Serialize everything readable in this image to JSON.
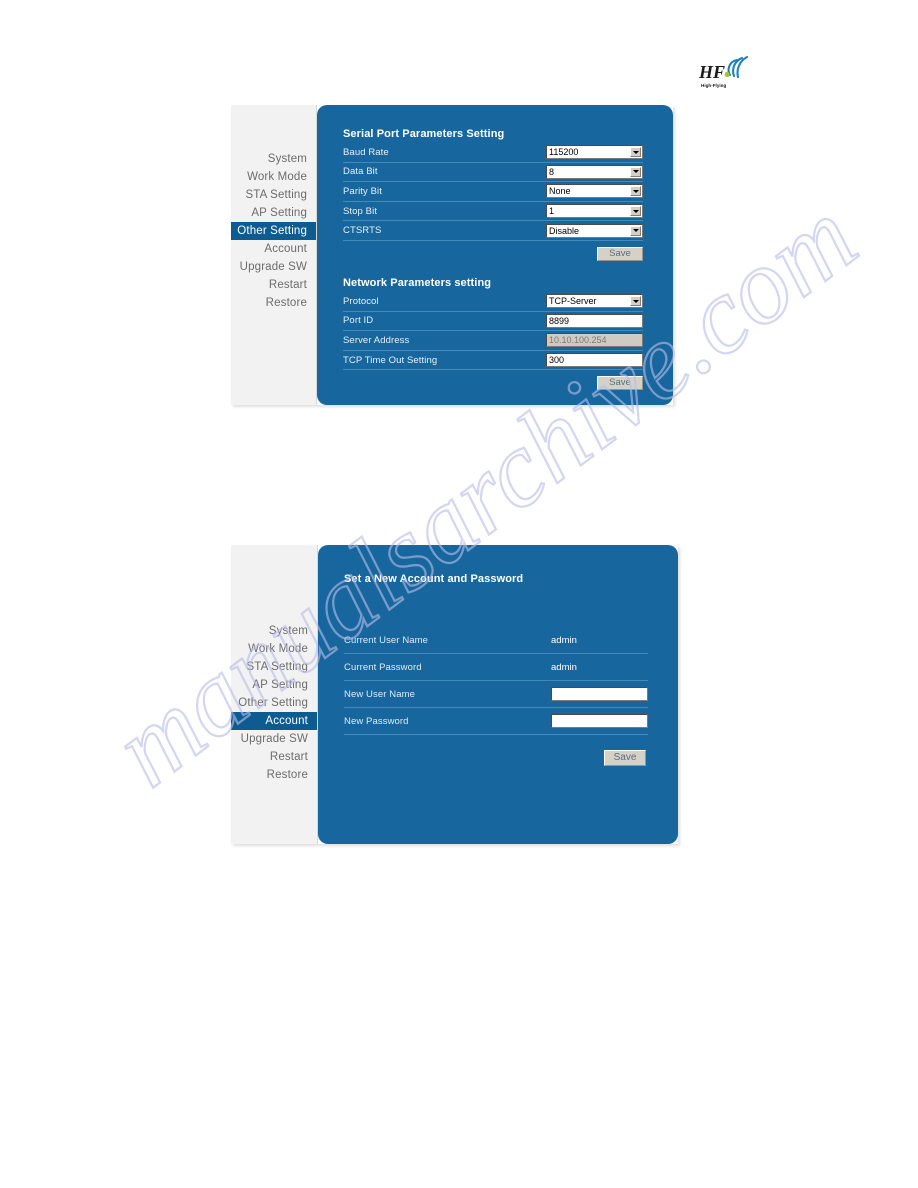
{
  "brand": {
    "logo_primary": "HF",
    "logo_tagline": "High-Flying",
    "logo_icon": "wifi-signal-icon",
    "accent_green": "#9ac63b",
    "accent_blue": "#1f7fc4"
  },
  "watermark": {
    "text": "manualsarchive.com",
    "color": "#b9bde8"
  },
  "colors": {
    "panel_blue": "#17679e",
    "sidebar_bg": "#f2f2f2",
    "nav_active_bg": "#0c5c92",
    "nav_text": "#6c6c6c",
    "row_divider": "#3f8cba",
    "button_face": "#d5d1c7",
    "button_text": "#5a6f85",
    "disabled_field": "#cfcbc3"
  },
  "panel_serial": {
    "nav": {
      "items": [
        {
          "label": "System",
          "active": false
        },
        {
          "label": "Work Mode",
          "active": false
        },
        {
          "label": "STA Setting",
          "active": false
        },
        {
          "label": "AP Setting",
          "active": false
        },
        {
          "label": "Other Setting",
          "active": true
        },
        {
          "label": "Account",
          "active": false
        },
        {
          "label": "Upgrade SW",
          "active": false
        },
        {
          "label": "Restart",
          "active": false
        },
        {
          "label": "Restore",
          "active": false
        }
      ]
    },
    "serial_section": {
      "title": "Serial Port Parameters Setting",
      "rows": [
        {
          "label": "Baud Rate",
          "control": "select",
          "value": "115200"
        },
        {
          "label": "Data Bit",
          "control": "select",
          "value": "8"
        },
        {
          "label": "Parity Bit",
          "control": "select",
          "value": "None"
        },
        {
          "label": "Stop Bit",
          "control": "select",
          "value": "1"
        },
        {
          "label": "CTSRTS",
          "control": "select",
          "value": "Disable"
        }
      ],
      "save_label": "Save"
    },
    "network_section": {
      "title": "Network Parameters setting",
      "rows": [
        {
          "label": "Protocol",
          "control": "select",
          "value": "TCP-Server",
          "disabled": false
        },
        {
          "label": "Port ID",
          "control": "input",
          "value": "8899",
          "disabled": false
        },
        {
          "label": "Server Address",
          "control": "input",
          "value": "10.10.100.254",
          "disabled": true
        },
        {
          "label": "TCP Time Out Setting",
          "control": "input",
          "value": "300",
          "disabled": false
        }
      ],
      "save_label": "Save"
    }
  },
  "panel_account": {
    "nav": {
      "items": [
        {
          "label": "System",
          "active": false
        },
        {
          "label": "Work Mode",
          "active": false
        },
        {
          "label": "STA Setting",
          "active": false
        },
        {
          "label": "AP Setting",
          "active": false
        },
        {
          "label": "Other Setting",
          "active": false
        },
        {
          "label": "Account",
          "active": true
        },
        {
          "label": "Upgrade SW",
          "active": false
        },
        {
          "label": "Restart",
          "active": false
        },
        {
          "label": "Restore",
          "active": false
        }
      ]
    },
    "section": {
      "title": "Set a New Account and Password",
      "rows": [
        {
          "label": "Current User Name",
          "control": "text",
          "value": "admin"
        },
        {
          "label": "Current Password",
          "control": "text",
          "value": "admin"
        },
        {
          "label": "New User Name",
          "control": "input",
          "value": ""
        },
        {
          "label": "New Password",
          "control": "input",
          "value": ""
        }
      ],
      "save_label": "Save"
    }
  }
}
